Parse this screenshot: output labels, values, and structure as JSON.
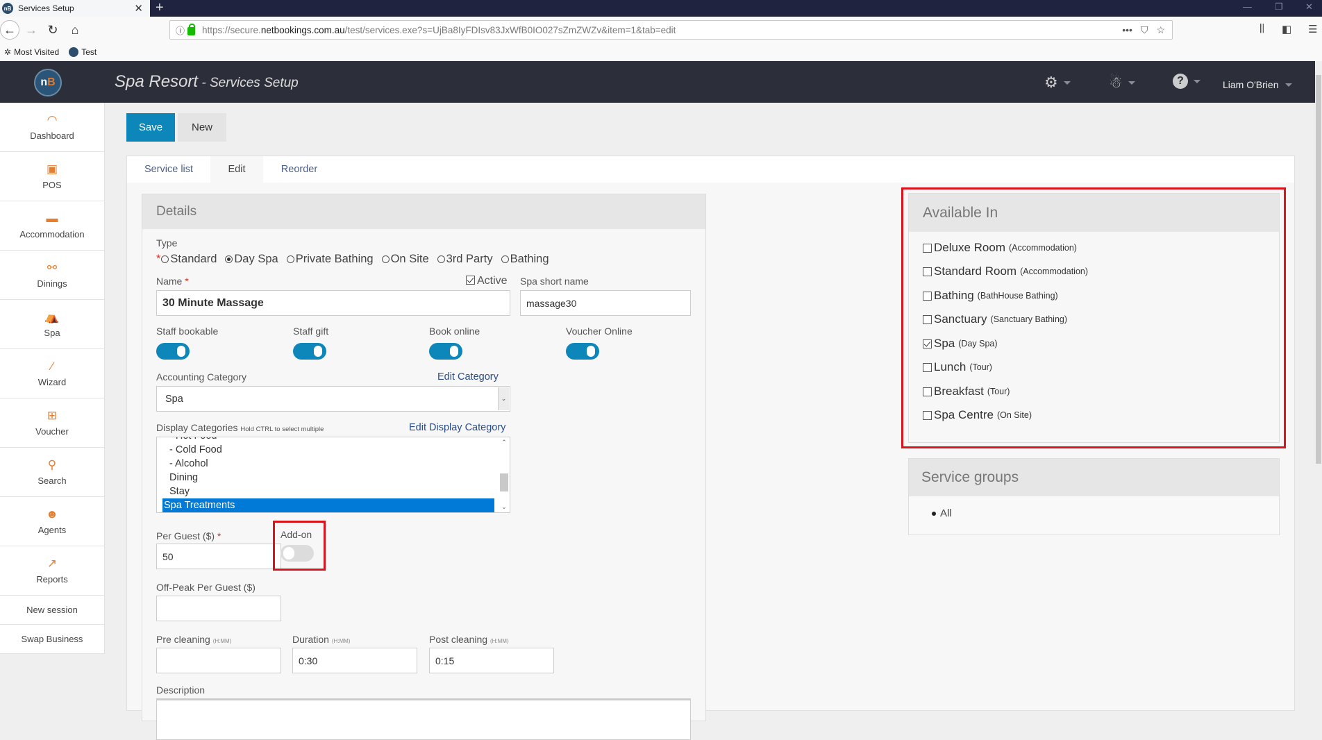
{
  "browser": {
    "tab_title": "Services Setup",
    "favicon_text": "nB",
    "url_prefix": "https://secure.",
    "url_domain": "netbookings.com.au",
    "url_path": "/test/services.exe?s=UjBa8IyFDIsv83JxWfB0IO027sZmZWZv&item=1&tab=edit",
    "bookmarks": [
      {
        "label": "Most Visited",
        "icon": "gear-icon"
      },
      {
        "label": "Test",
        "icon": "nb-favicon"
      }
    ]
  },
  "header": {
    "logo_n": "n",
    "logo_b": "B",
    "title": "Spa Resort",
    "separator": " - ",
    "subtitle": "Services Setup",
    "user_name": "Liam O'Brien",
    "icons": [
      "settings-gears-icon",
      "agent-icon",
      "help-icon"
    ]
  },
  "sidebar": {
    "items": [
      {
        "label": "Dashboard",
        "icon": "gauge-icon"
      },
      {
        "label": "POS",
        "icon": "pos-icon"
      },
      {
        "label": "Accommodation",
        "icon": "bed-icon"
      },
      {
        "label": "Dinings",
        "icon": "dining-icon"
      },
      {
        "label": "Spa",
        "icon": "massage-icon"
      },
      {
        "label": "Wizard",
        "icon": "wand-icon"
      },
      {
        "label": "Voucher",
        "icon": "gift-icon"
      },
      {
        "label": "Search",
        "icon": "search-icon"
      },
      {
        "label": "Agents",
        "icon": "agent-icon"
      },
      {
        "label": "Reports",
        "icon": "chart-icon"
      }
    ],
    "links": [
      "New session",
      "Swap Business"
    ]
  },
  "toolbar": {
    "save_label": "Save",
    "new_label": "New"
  },
  "tabs": [
    {
      "label": "Service list",
      "active": false
    },
    {
      "label": "Edit",
      "active": true
    },
    {
      "label": "Reorder",
      "active": false
    }
  ],
  "details": {
    "title": "Details",
    "type_label": "Type",
    "type_options": [
      {
        "label": "Standard",
        "selected": false
      },
      {
        "label": "Day Spa",
        "selected": true
      },
      {
        "label": "Private Bathing",
        "selected": false
      },
      {
        "label": "On Site",
        "selected": false
      },
      {
        "label": "3rd Party",
        "selected": false
      },
      {
        "label": "Bathing",
        "selected": false
      }
    ],
    "name_label": "Name",
    "name_value": "30 Minute Massage",
    "active_label": "Active",
    "active_checked": true,
    "short_name_label": "Spa short name",
    "short_name_value": "massage30",
    "toggles": [
      {
        "label": "Staff bookable",
        "on": true
      },
      {
        "label": "Staff gift",
        "on": true
      },
      {
        "label": "Book online",
        "on": true
      },
      {
        "label": "Voucher Online",
        "on": true
      }
    ],
    "accounting_label": "Accounting Category",
    "accounting_link": "Edit Category",
    "accounting_value": "Spa",
    "display_label": "Display Categories",
    "display_hint": "Hold CTRL to select multiple",
    "display_link": "Edit Display Category",
    "display_options": [
      {
        "label": "- Hot Food",
        "selected": false
      },
      {
        "label": "- Cold Food",
        "selected": false
      },
      {
        "label": "- Alcohol",
        "selected": false
      },
      {
        "label": "Dining",
        "selected": false
      },
      {
        "label": "Stay",
        "selected": false
      },
      {
        "label": "Spa Treatments",
        "selected": true
      }
    ],
    "per_guest_label": "Per Guest ($)",
    "per_guest_value": "50",
    "addon_label": "Add-on",
    "addon_on": false,
    "offpeak_label": "Off-Peak Per Guest ($)",
    "offpeak_value": "",
    "pre_clean_label": "Pre cleaning",
    "pre_clean_value": "",
    "duration_label": "Duration",
    "duration_value": "0:30",
    "post_clean_label": "Post cleaning",
    "post_clean_value": "0:15",
    "hmm_hint": "(H:MM)",
    "description_label": "Description",
    "description_value": ""
  },
  "available_in": {
    "title": "Available In",
    "items": [
      {
        "name": "Deluxe Room",
        "category": "(Accommodation)",
        "checked": false
      },
      {
        "name": "Standard Room",
        "category": "(Accommodation)",
        "checked": false
      },
      {
        "name": "Bathing",
        "category": "(BathHouse Bathing)",
        "checked": false
      },
      {
        "name": "Sanctuary",
        "category": "(Sanctuary Bathing)",
        "checked": false
      },
      {
        "name": "Spa",
        "category": "(Day Spa)",
        "checked": true
      },
      {
        "name": "Lunch",
        "category": "(Tour)",
        "checked": false
      },
      {
        "name": "Breakfast",
        "category": "(Tour)",
        "checked": false
      },
      {
        "name": "Spa Centre",
        "category": "(On Site)",
        "checked": false
      }
    ]
  },
  "service_groups": {
    "title": "Service groups",
    "items": [
      "All"
    ]
  },
  "colors": {
    "accent": "#0d87ba",
    "header_bg": "#2c2f3a",
    "sidebar_icon": "#e67e30",
    "highlight_box": "#d9141c",
    "selection": "#0079d7"
  }
}
